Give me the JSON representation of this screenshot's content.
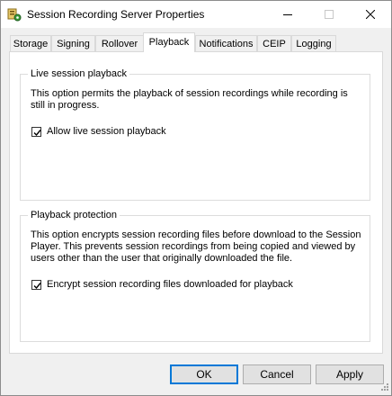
{
  "window": {
    "title": "Session Recording Server Properties"
  },
  "tabs": [
    {
      "label": "Storage"
    },
    {
      "label": "Signing"
    },
    {
      "label": "Rollover"
    },
    {
      "label": "Playback"
    },
    {
      "label": "Notifications"
    },
    {
      "label": "CEIP"
    },
    {
      "label": "Logging"
    }
  ],
  "active_tab": "Playback",
  "live_playback": {
    "title": "Live session playback",
    "description": "This option permits the playback of session recordings while recording is still in progress.",
    "checkbox_label": "Allow live session playback",
    "checked": true
  },
  "playback_protection": {
    "title": "Playback protection",
    "description": "This option encrypts session recording files before download to the Session Player. This prevents session recordings from being copied and viewed by users other than the user that originally downloaded the file.",
    "checkbox_label": "Encrypt session recording files downloaded for playback",
    "checked": true
  },
  "buttons": {
    "ok": "OK",
    "cancel": "Cancel",
    "apply": "Apply"
  },
  "colors": {
    "accent": "#0078d7",
    "panel": "#ffffff",
    "dialog": "#f0f0f0"
  }
}
